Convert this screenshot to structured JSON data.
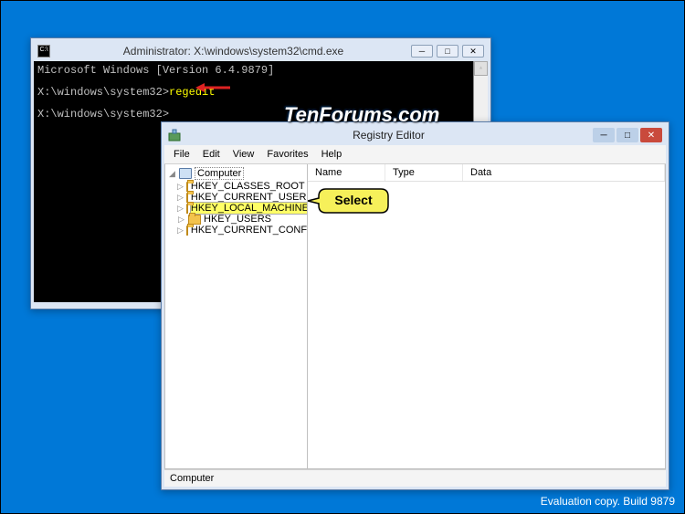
{
  "desktop": {
    "eval_text": "Evaluation copy. Build 9879",
    "watermark": "TenForums.com"
  },
  "cmd": {
    "title": "Administrator: X:\\windows\\system32\\cmd.exe",
    "line1": "Microsoft Windows [Version 6.4.9879]",
    "prompt1": "X:\\windows\\system32>",
    "typed": "regedit",
    "prompt2": "X:\\windows\\system32>"
  },
  "reg": {
    "title": "Registry Editor",
    "menu": {
      "file": "File",
      "edit": "Edit",
      "view": "View",
      "favorites": "Favorites",
      "help": "Help"
    },
    "tree": {
      "root": "Computer",
      "items": [
        "HKEY_CLASSES_ROOT",
        "HKEY_CURRENT_USER",
        "HKEY_LOCAL_MACHINE",
        "HKEY_USERS",
        "HKEY_CURRENT_CONFIG"
      ]
    },
    "cols": {
      "name": "Name",
      "type": "Type",
      "data": "Data"
    },
    "status": "Computer"
  },
  "callout": {
    "text": "Select"
  }
}
